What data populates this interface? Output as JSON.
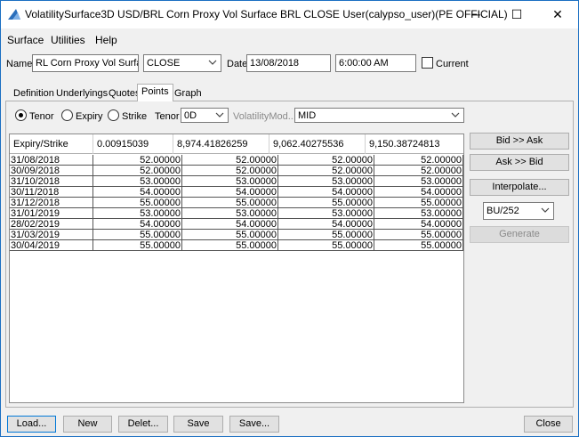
{
  "window": {
    "title": "VolatilitySurface3D USD/BRL Corn Proxy Vol Surface BRL CLOSE User(calypso_user)(PE OFFICIAL)",
    "minimize_glyph": "─",
    "maximize_glyph": "☐",
    "close_glyph": "✕"
  },
  "menu": [
    "Surface",
    "Utilities",
    "Help"
  ],
  "header": {
    "name_label": "Name",
    "name_value": "RL Corn Proxy Vol Surface",
    "quote_set_value": "CLOSE",
    "date_label": "Date",
    "date_value": "13/08/2018",
    "time_value": "6:00:00 AM",
    "current_label": "Current",
    "current_checked": false
  },
  "tabs": [
    {
      "label": "Definition",
      "active": false
    },
    {
      "label": "Underlyings",
      "active": false
    },
    {
      "label": "Quotes",
      "active": false
    },
    {
      "label": "Points",
      "active": true
    },
    {
      "label": "Graph",
      "active": false
    }
  ],
  "options": {
    "radio_tenor": "Tenor",
    "radio_expiry": "Expiry",
    "radio_strike": "Strike",
    "selected": "Tenor",
    "tenor_label": "Tenor",
    "tenor_value": "0D",
    "vol_mod_label": "VolatilityMod...",
    "vol_mod_value": "MID"
  },
  "grid": {
    "columns": [
      "Expiry/Strike",
      "0.00915039",
      "8,974.41826259",
      "9,062.40275536",
      "9,150.38724813"
    ],
    "rows": [
      [
        "31/08/2018",
        "52.00000",
        "52.00000",
        "52.00000",
        "52.00000"
      ],
      [
        "30/09/2018",
        "52.00000",
        "52.00000",
        "52.00000",
        "52.00000"
      ],
      [
        "31/10/2018",
        "53.00000",
        "53.00000",
        "53.00000",
        "53.00000"
      ],
      [
        "30/11/2018",
        "54.00000",
        "54.00000",
        "54.00000",
        "54.00000"
      ],
      [
        "31/12/2018",
        "55.00000",
        "55.00000",
        "55.00000",
        "55.00000"
      ],
      [
        "31/01/2019",
        "53.00000",
        "53.00000",
        "53.00000",
        "53.00000"
      ],
      [
        "28/02/2019",
        "54.00000",
        "54.00000",
        "54.00000",
        "54.00000"
      ],
      [
        "31/03/2019",
        "55.00000",
        "55.00000",
        "55.00000",
        "55.00000"
      ],
      [
        "30/04/2019",
        "55.00000",
        "55.00000",
        "55.00000",
        "55.00000"
      ]
    ]
  },
  "side": {
    "bid_ask": "Bid >> Ask",
    "ask_bid": "Ask >> Bid",
    "interpolate": "Interpolate...",
    "daycount_value": "BU/252",
    "generate": "Generate"
  },
  "bottom": {
    "load": "Load...",
    "new": "New",
    "delete": "Delet...",
    "save": "Save",
    "save_as": "Save...",
    "close": "Close"
  },
  "colors": {
    "accent": "#0078d7",
    "window_border": "#1b6fc2"
  }
}
